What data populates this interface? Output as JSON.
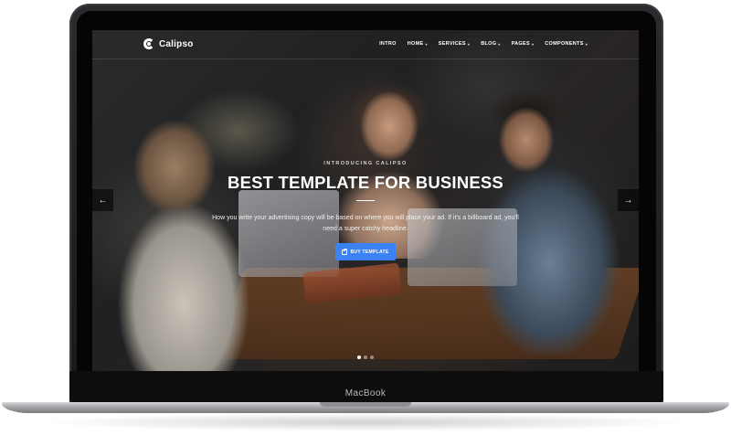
{
  "device": {
    "brand_label": "MacBook"
  },
  "site": {
    "logo_text": "Calipso",
    "nav": [
      {
        "label": "INTRO",
        "has_dropdown": false
      },
      {
        "label": "HOME",
        "has_dropdown": true
      },
      {
        "label": "SERVICES",
        "has_dropdown": true
      },
      {
        "label": "BLOG",
        "has_dropdown": true
      },
      {
        "label": "PAGES",
        "has_dropdown": true
      },
      {
        "label": "COMPONENTS",
        "has_dropdown": true
      }
    ],
    "hero": {
      "eyebrow": "INTRODUCING CALIPSO",
      "headline": "BEST TEMPLATE FOR BUSINESS",
      "subtext": "How you write your advertising copy will be based on where you will place your ad. If it's a billboard ad, you'll need a super catchy headline.",
      "cta_label": "BUY TEMPLATE",
      "cta_color": "#3b82f6"
    },
    "slider": {
      "slide_count": 3,
      "active_slide": 1,
      "prev_icon": "arrow-left-icon",
      "next_icon": "arrow-right-icon"
    }
  }
}
